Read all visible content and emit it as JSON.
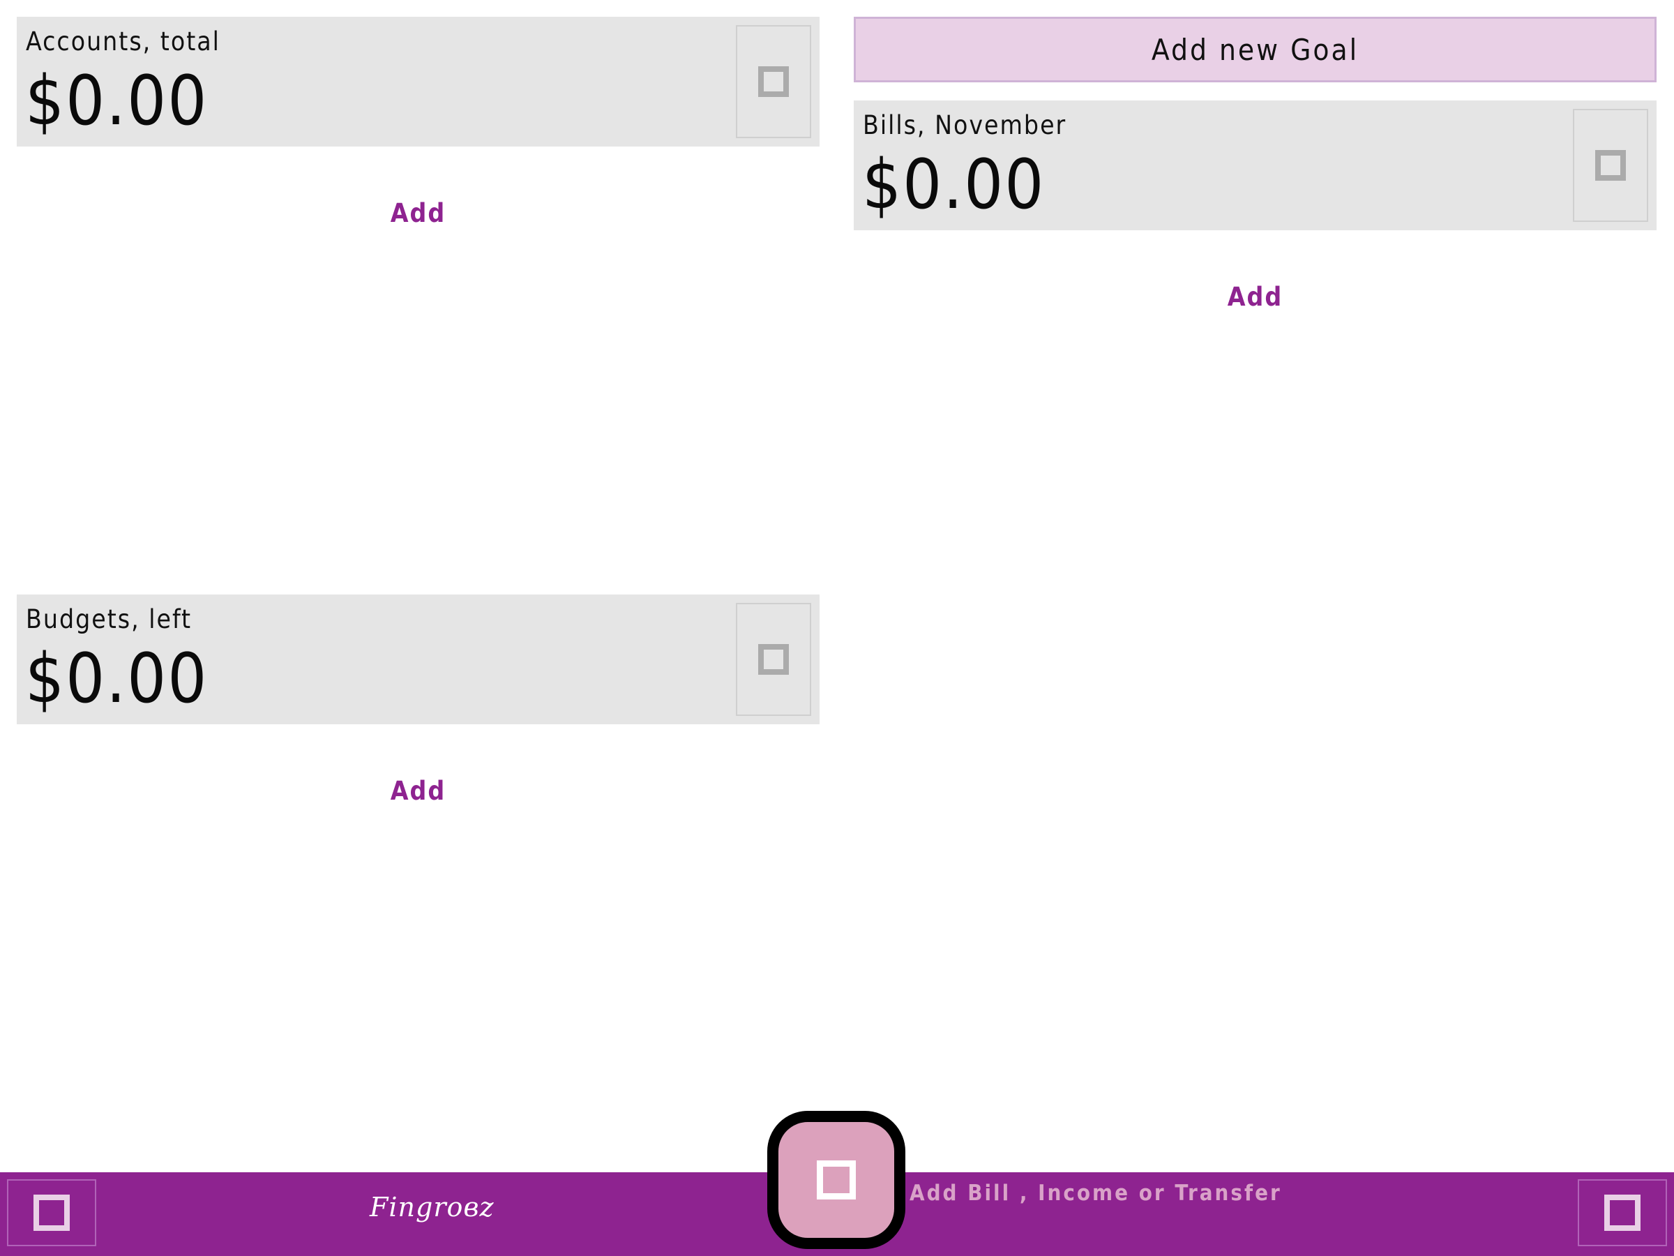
{
  "accounts": {
    "title": "Accounts, total",
    "amount": "$0.00",
    "add_label": "Add",
    "action_icon": "square-icon"
  },
  "budgets": {
    "title": "Budgets, left",
    "amount": "$0.00",
    "add_label": "Add",
    "action_icon": "square-icon"
  },
  "goals": {
    "add_goal_label": "Add new Goal"
  },
  "bills": {
    "title": "Bills, November",
    "amount": "$0.00",
    "add_label": "Add",
    "action_icon": "square-icon"
  },
  "bottom_bar": {
    "logo_text": "Fingroвz",
    "fab_caption": "Add Bill , Income or Transfer",
    "left_icon": "square-icon",
    "right_icon": "square-icon",
    "fab_icon": "square-icon"
  },
  "colors": {
    "brand": "#8e2390",
    "card_bg": "#e5e5e5",
    "goal_button_bg": "#e9d0e6",
    "fab_bg": "#dca1bc",
    "caption": "#d9a2c8"
  }
}
